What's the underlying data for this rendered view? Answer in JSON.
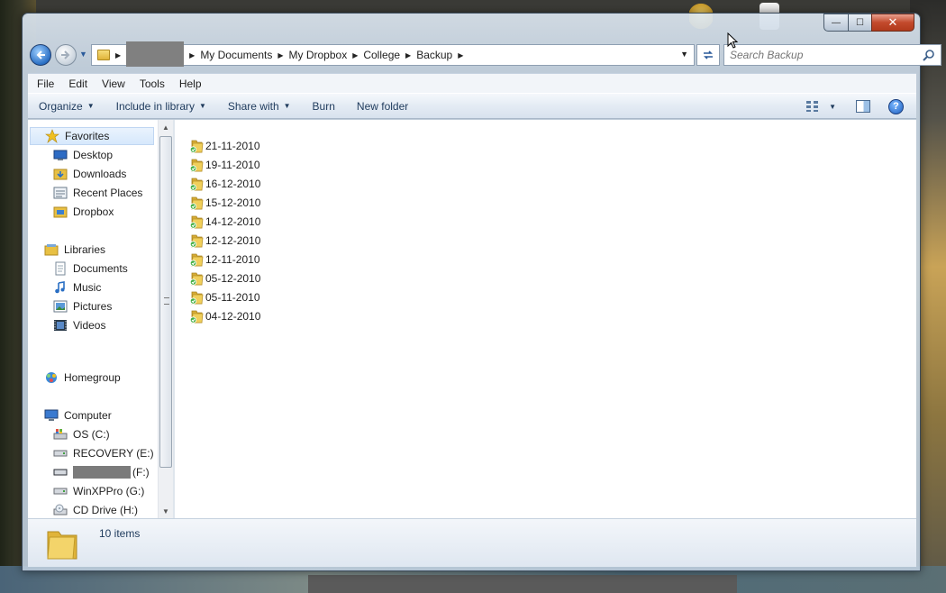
{
  "window": {
    "title_buttons": {
      "minimize": "—",
      "maximize": "☐",
      "close": "✕"
    }
  },
  "address": {
    "crumbs": [
      "My Documents",
      "My Dropbox",
      "College",
      "Backup"
    ]
  },
  "search": {
    "placeholder": "Search Backup"
  },
  "menu": [
    "File",
    "Edit",
    "View",
    "Tools",
    "Help"
  ],
  "toolbar": {
    "organize": "Organize",
    "include_in_library": "Include in library",
    "share_with": "Share with",
    "burn": "Burn",
    "new_folder": "New folder",
    "help": "?"
  },
  "sidebar": {
    "favorites": {
      "label": "Favorites",
      "items": [
        "Desktop",
        "Downloads",
        "Recent Places",
        "Dropbox"
      ]
    },
    "libraries": {
      "label": "Libraries",
      "items": [
        "Documents",
        "Music",
        "Pictures",
        "Videos"
      ]
    },
    "homegroup": "Homegroup",
    "computer": {
      "label": "Computer",
      "items": [
        "OS (C:)",
        "RECOVERY (E:)",
        "(F:)",
        "WinXPPro (G:)",
        "CD Drive (H:)"
      ]
    }
  },
  "files": [
    "21-11-2010",
    "19-11-2010",
    "16-12-2010",
    "15-12-2010",
    "14-12-2010",
    "12-12-2010",
    "12-11-2010",
    "05-12-2010",
    "05-11-2010",
    "04-12-2010"
  ],
  "status": {
    "item_count": "10 items"
  },
  "colors": {
    "folder": "#e8c043",
    "sync_check": "#3fae3f",
    "accent": "#1e5fc0"
  }
}
